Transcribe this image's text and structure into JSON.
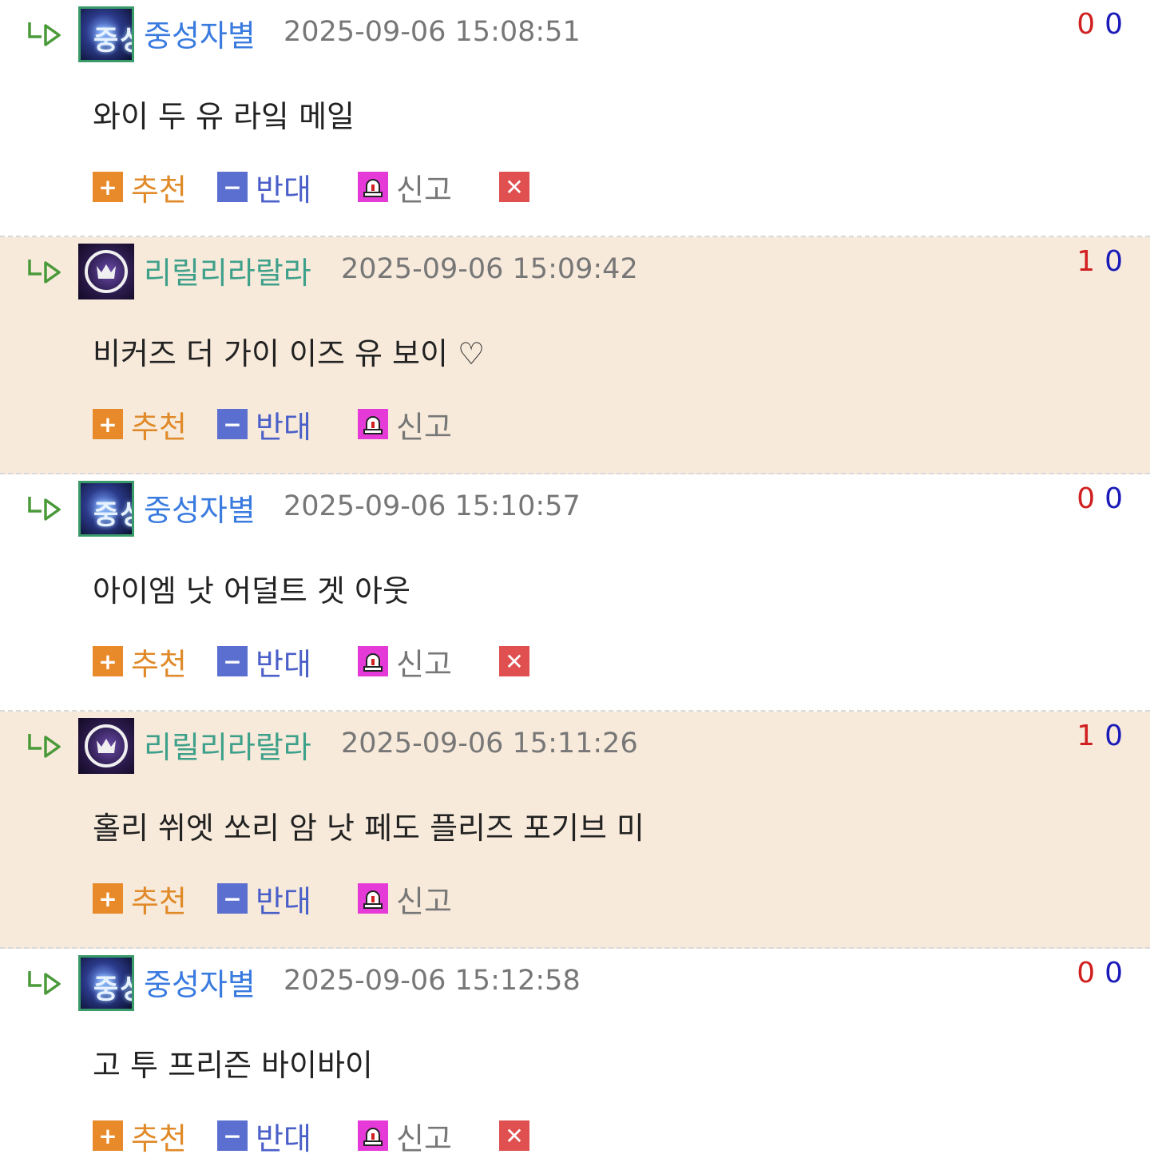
{
  "colors": {
    "highlight_bg": "#f7eadb",
    "nick_blue": "#3a7be0",
    "nick_teal": "#3ea08a",
    "upvote_red": "#d02020",
    "downvote_blue": "#1a1ab8",
    "recommend_orange": "#e08a2a",
    "oppose_blue": "#4a5fc8",
    "report_magenta": "#e63ad8",
    "delete_red": "#e05050"
  },
  "actions": {
    "recommend_label": "추천",
    "oppose_label": "반대",
    "report_label": "신고",
    "recommend_icon": "plus-icon",
    "oppose_icon": "minus-icon",
    "report_icon": "siren-icon",
    "delete_icon": "close-icon"
  },
  "comments": [
    {
      "nickname": "중성자별",
      "avatar_text": "중성",
      "timestamp": "2025-09-06 15:08:51",
      "upvotes": "0",
      "downvotes": "0",
      "text": "와이 두 유 라잌 메일"
    },
    {
      "nickname": "리릴리라랄라",
      "timestamp": "2025-09-06 15:09:42",
      "upvotes": "1",
      "downvotes": "0",
      "text": "비커즈 더 가이 이즈 유 보이 ♡"
    },
    {
      "nickname": "중성자별",
      "avatar_text": "중성",
      "timestamp": "2025-09-06 15:10:57",
      "upvotes": "0",
      "downvotes": "0",
      "text": "아이엠 낫 어덜트 겟 아웃"
    },
    {
      "nickname": "리릴리라랄라",
      "timestamp": "2025-09-06 15:11:26",
      "upvotes": "1",
      "downvotes": "0",
      "text": "홀리 쒸엣 쏘리 암 낫 페도 플리즈 포기브 미"
    },
    {
      "nickname": "중성자별",
      "avatar_text": "중성",
      "timestamp": "2025-09-06 15:12:58",
      "upvotes": "0",
      "downvotes": "0",
      "text": "고 투 프리즌 바이바이"
    }
  ]
}
